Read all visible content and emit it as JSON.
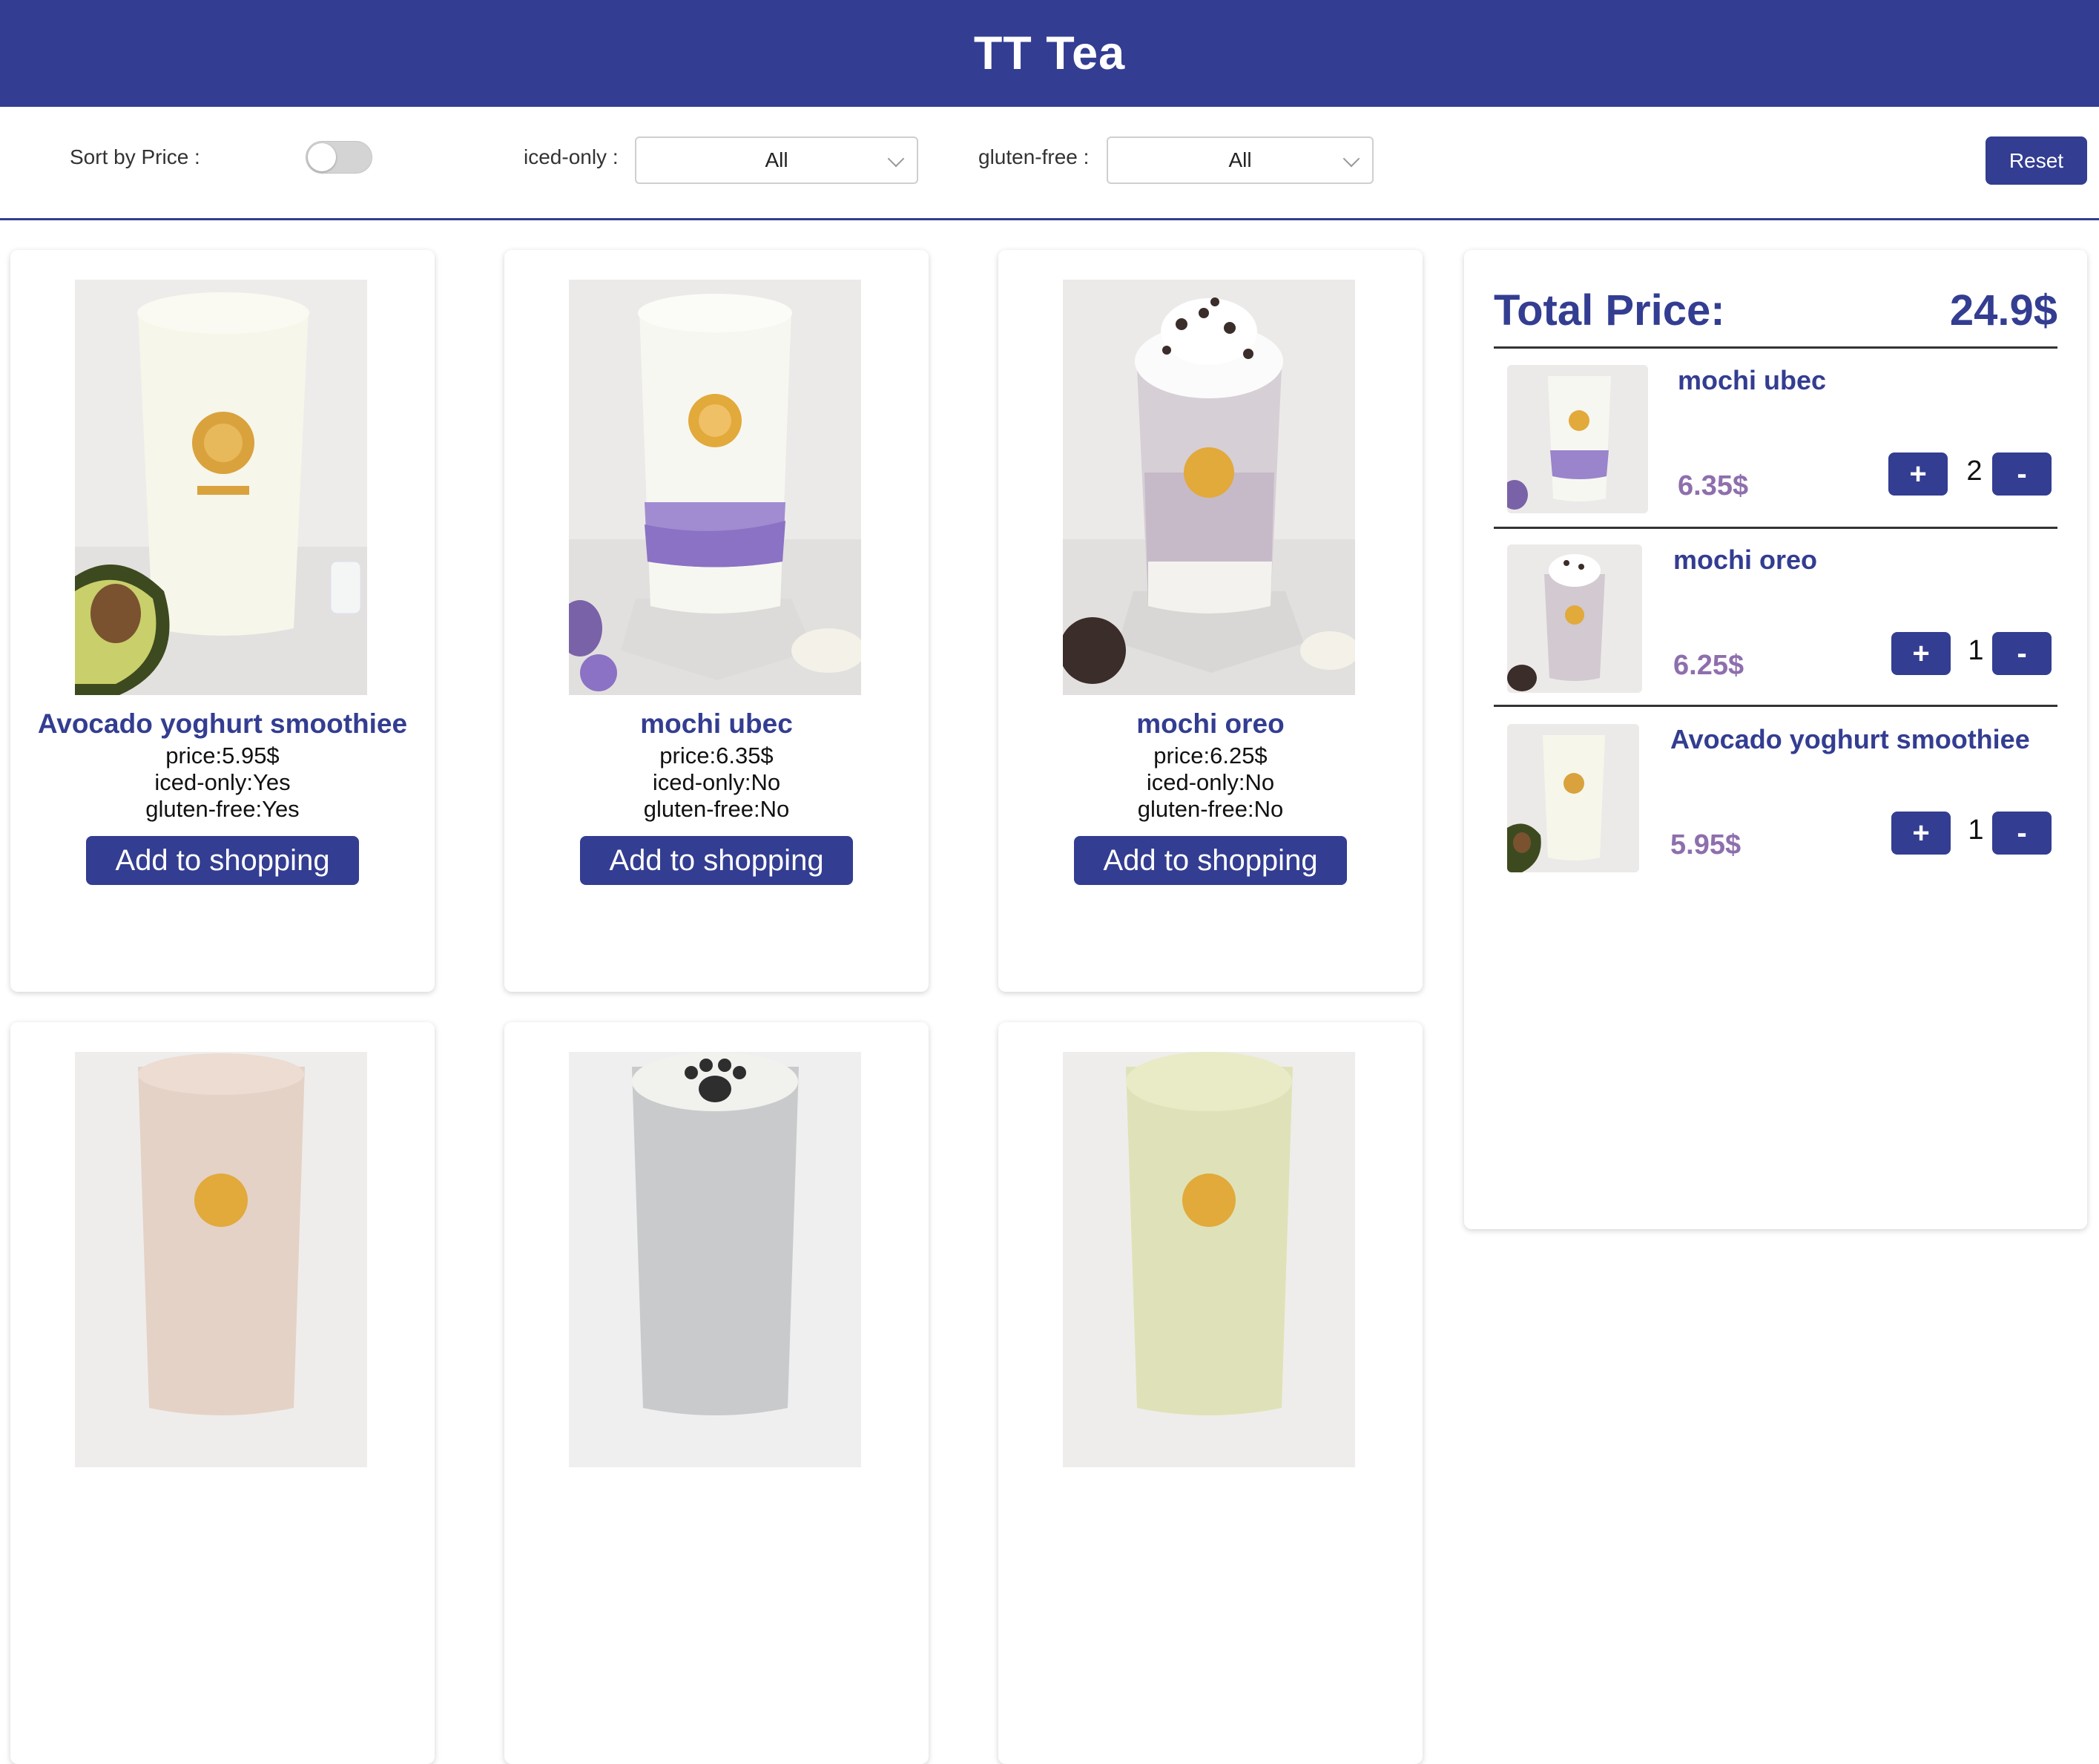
{
  "app": {
    "title": "TT Tea"
  },
  "filters": {
    "sort_label": "Sort by Price :",
    "sort_enabled": false,
    "iced_label": "iced-only :",
    "iced_value": "All",
    "gluten_label": "gluten-free :",
    "gluten_value": "All",
    "reset_label": "Reset"
  },
  "products": [
    {
      "name": "Avocado yoghurt smoothiee",
      "price": "price:5.95$",
      "iced": "iced-only:Yes",
      "gluten": "gluten-free:Yes",
      "button": "Add to shopping"
    },
    {
      "name": "mochi ubec",
      "price": "price:6.35$",
      "iced": "iced-only:No",
      "gluten": "gluten-free:No",
      "button": "Add to shopping"
    },
    {
      "name": "mochi oreo",
      "price": "price:6.25$",
      "iced": "iced-only:No",
      "gluten": "gluten-free:No",
      "button": "Add to shopping"
    }
  ],
  "cart": {
    "total_label": "Total Price:",
    "total_value": "24.9$",
    "items": [
      {
        "name": "mochi ubec",
        "price": "6.35$",
        "qty": "2",
        "plus": "+",
        "minus": "-"
      },
      {
        "name": "mochi oreo",
        "price": "6.25$",
        "qty": "1",
        "plus": "+",
        "minus": "-"
      },
      {
        "name": "Avocado yoghurt smoothiee",
        "price": "5.95$",
        "qty": "1",
        "plus": "+",
        "minus": "-"
      }
    ]
  },
  "colors": {
    "brand": "#333d91",
    "price_accent": "#8e6fad"
  }
}
